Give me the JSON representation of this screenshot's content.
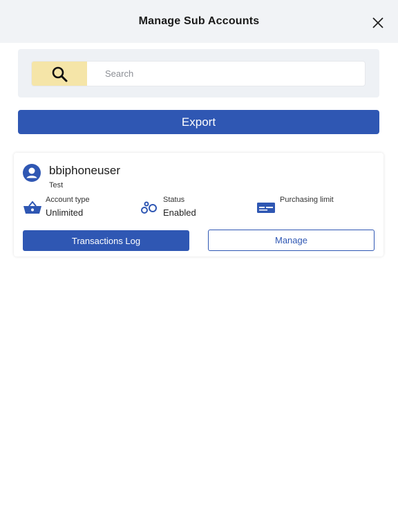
{
  "header": {
    "title": "Manage Sub Accounts",
    "close_icon": "close-icon"
  },
  "search": {
    "icon": "search-icon",
    "placeholder": "Search",
    "value": "",
    "button_color": "#f5e5a8"
  },
  "export": {
    "label": "Export",
    "color": "#2f57b3"
  },
  "account": {
    "avatar_icon": "user-circle-icon",
    "username": "bbiphoneuser",
    "subtitle": "Test",
    "info": [
      {
        "icon": "basket-icon",
        "label": "Account type",
        "value": "Unlimited"
      },
      {
        "icon": "status-link-icon",
        "label": "Status",
        "value": "Enabled"
      },
      {
        "icon": "credit-card-icon",
        "label": "Purchasing limit",
        "value": ""
      }
    ],
    "actions": {
      "transactions_label": "Transactions Log",
      "manage_label": "Manage"
    }
  },
  "colors": {
    "accent": "#2f57b3",
    "header_bg": "#f1f3f6",
    "panel_bg": "#eef1f5"
  }
}
